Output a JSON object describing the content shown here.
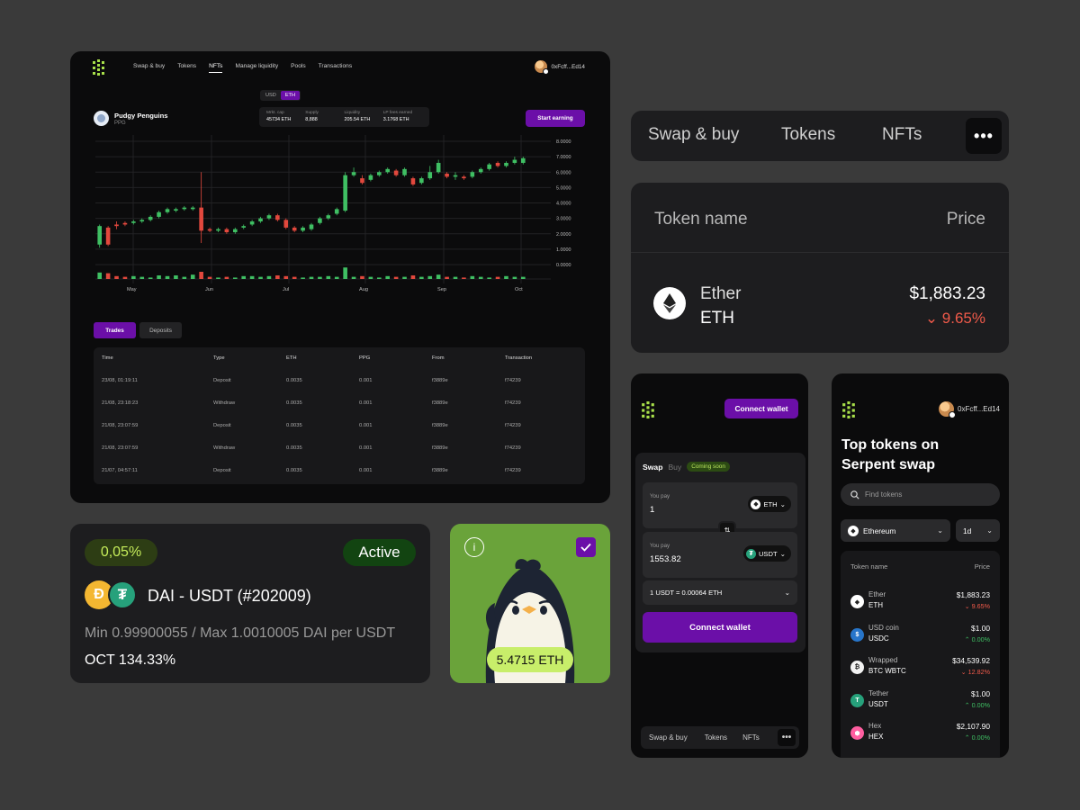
{
  "dashboard": {
    "nav": [
      "Swap & buy",
      "Tokens",
      "NFTs",
      "Manage liquidity",
      "Pools",
      "Transactions"
    ],
    "active_nav": "NFTs",
    "wallet": "0xFcff...Ed14",
    "currency_toggle": [
      "USD",
      "ETH"
    ],
    "currency_selected": "ETH",
    "collection_name": "Pudgy Penguins",
    "collection_symbol": "PPG",
    "stats": [
      {
        "label": "Mrkt. cap",
        "value": "45734 ETH"
      },
      {
        "label": "Supply",
        "value": "8,888"
      },
      {
        "label": "Liquidity",
        "value": "205.54 ETH"
      },
      {
        "label": "LP fees earned",
        "value": "3.1768 ETH"
      }
    ],
    "start_button": "Start earning",
    "tabs": [
      "Trades",
      "Deposits"
    ],
    "active_tab": "Trades",
    "table_headers": [
      "Time",
      "Type",
      "ETH",
      "PPG",
      "From",
      "Transaction"
    ],
    "table_rows": [
      [
        "23/08, 01:19:11",
        "Deposit",
        "0.0035",
        "0.001",
        "f3889e",
        "f74239"
      ],
      [
        "21/08, 23:18:23",
        "Withdraw",
        "0.0035",
        "0.001",
        "f3889e",
        "f74239"
      ],
      [
        "21/08, 23:07:59",
        "Deposit",
        "0.0035",
        "0.001",
        "f3889e",
        "f74239"
      ],
      [
        "21/08, 23:07:59",
        "Withdraw",
        "0.0035",
        "0.001",
        "f3889e",
        "f74239"
      ],
      [
        "21/07, 04:57:11",
        "Deposit",
        "0.0035",
        "0.001",
        "f3889e",
        "f74239"
      ]
    ]
  },
  "chart_data": {
    "type": "candlestick",
    "months": [
      "May",
      "Jun",
      "Jul",
      "Aug",
      "Sep",
      "Oct"
    ],
    "y_ticks": [
      "8.0000",
      "7.0000",
      "6.0000",
      "5.0000",
      "4.0000",
      "3.0000",
      "2.0000",
      "1.0000",
      "0.0000"
    ],
    "ylim": [
      0,
      8
    ],
    "candles": [
      [
        1.3,
        2.5,
        1.1,
        2.6
      ],
      [
        2.4,
        1.3,
        1.2,
        2.5
      ],
      [
        2.6,
        2.5,
        2.3,
        2.8
      ],
      [
        2.7,
        2.6,
        2.5,
        2.8
      ],
      [
        2.7,
        2.8,
        2.6,
        2.9
      ],
      [
        2.8,
        2.9,
        2.7,
        3.0
      ],
      [
        2.9,
        3.1,
        2.8,
        3.2
      ],
      [
        3.1,
        3.4,
        3.0,
        3.5
      ],
      [
        3.4,
        3.6,
        3.3,
        3.7
      ],
      [
        3.5,
        3.6,
        3.4,
        3.7
      ],
      [
        3.6,
        3.7,
        3.5,
        3.8
      ],
      [
        3.6,
        3.7,
        3.5,
        3.8
      ],
      [
        3.7,
        2.2,
        1.4,
        6.0
      ],
      [
        2.3,
        2.2,
        2.1,
        2.4
      ],
      [
        2.2,
        2.3,
        2.1,
        2.4
      ],
      [
        2.3,
        2.1,
        2.0,
        2.4
      ],
      [
        2.1,
        2.3,
        2.0,
        2.4
      ],
      [
        2.4,
        2.5,
        2.3,
        2.6
      ],
      [
        2.6,
        2.8,
        2.5,
        2.9
      ],
      [
        2.8,
        3.0,
        2.7,
        3.1
      ],
      [
        3.0,
        3.2,
        2.9,
        3.3
      ],
      [
        3.2,
        2.9,
        2.8,
        3.3
      ],
      [
        2.9,
        2.4,
        2.3,
        3.0
      ],
      [
        2.4,
        2.2,
        2.1,
        2.5
      ],
      [
        2.2,
        2.4,
        2.1,
        2.5
      ],
      [
        2.3,
        2.6,
        2.2,
        2.7
      ],
      [
        2.7,
        3.0,
        2.6,
        3.1
      ],
      [
        3.0,
        3.2,
        2.9,
        3.3
      ],
      [
        3.3,
        3.6,
        3.2,
        3.7
      ],
      [
        3.5,
        5.8,
        3.4,
        6.0
      ],
      [
        5.8,
        6.0,
        5.7,
        6.3
      ],
      [
        5.6,
        5.3,
        5.2,
        5.8
      ],
      [
        5.5,
        5.8,
        5.4,
        5.9
      ],
      [
        5.8,
        6.0,
        5.7,
        6.1
      ],
      [
        6.0,
        6.2,
        5.9,
        6.3
      ],
      [
        6.1,
        5.8,
        5.7,
        6.2
      ],
      [
        5.8,
        6.2,
        5.7,
        6.3
      ],
      [
        5.6,
        5.2,
        5.1,
        5.7
      ],
      [
        5.3,
        5.6,
        5.2,
        5.7
      ],
      [
        5.6,
        6.0,
        5.5,
        6.4
      ],
      [
        6.0,
        6.6,
        5.9,
        6.8
      ],
      [
        5.9,
        5.7,
        5.6,
        6.0
      ],
      [
        5.7,
        5.8,
        5.5,
        6.0
      ],
      [
        5.7,
        5.6,
        5.5,
        5.8
      ],
      [
        5.7,
        6.0,
        5.6,
        6.1
      ],
      [
        6.0,
        6.2,
        5.9,
        6.3
      ],
      [
        6.2,
        6.5,
        6.1,
        6.6
      ],
      [
        6.6,
        6.4,
        6.3,
        6.7
      ],
      [
        6.4,
        6.6,
        6.3,
        6.7
      ],
      [
        6.6,
        6.8,
        6.5,
        7.0
      ],
      [
        6.6,
        6.9,
        6.5,
        7.0
      ]
    ],
    "volumes": [
      0.9,
      0.8,
      0.4,
      0.3,
      0.4,
      0.3,
      0.2,
      0.5,
      0.4,
      0.5,
      0.3,
      0.6,
      1.0,
      0.3,
      0.2,
      0.3,
      0.2,
      0.4,
      0.4,
      0.3,
      0.4,
      0.5,
      0.4,
      0.3,
      0.2,
      0.3,
      0.3,
      0.4,
      0.3,
      1.6,
      0.3,
      0.4,
      0.3,
      0.2,
      0.4,
      0.3,
      0.3,
      0.5,
      0.3,
      0.4,
      0.6,
      0.3,
      0.3,
      0.2,
      0.4,
      0.3,
      0.2,
      0.3,
      0.4,
      0.3,
      0.3
    ]
  },
  "topnav": {
    "items": [
      "Swap & buy",
      "Tokens",
      "NFTs"
    ],
    "more": "•••"
  },
  "pricecard": {
    "header_name": "Token name",
    "header_price": "Price",
    "token_name": "Ether",
    "token_symbol": "ETH",
    "price": "$1,883.23",
    "change": "9.65%"
  },
  "lpcard": {
    "fee": "0,05%",
    "status": "Active",
    "title": "DAI - USDT (#202009)",
    "range": "Min 0.99900055 / Max 1.0010005 DAI per USDT",
    "oct": "OCT 134.33%",
    "colors": {
      "dai": "#f4b731",
      "usdt": "#26a17b"
    }
  },
  "nftcard": {
    "info_icon": "i",
    "price": "5.4715 ETH"
  },
  "swapcard": {
    "connect_top": "Connect wallet",
    "tab_swap": "Swap",
    "tab_buy": "Buy",
    "coming_soon": "Coming soon",
    "pay_label": "You pay",
    "pay_value_1": "1",
    "pay_token_1": "ETH",
    "pay_value_2": "1553.82",
    "pay_token_2": "USDT",
    "rate": "1 USDT = 0.00064 ETH",
    "connect_main": "Connect wallet",
    "bottom_nav": [
      "Swap & buy",
      "Tokens",
      "NFTs"
    ],
    "bottom_more": "•••"
  },
  "tokcard": {
    "wallet": "0xFcff...Ed14",
    "title_line1": "Top tokens on",
    "title_line2": "Serpent swap",
    "search_placeholder": "Find tokens",
    "network": "Ethereum",
    "timeframe": "1d",
    "col_name": "Token name",
    "col_price": "Price",
    "tokens": [
      {
        "name": "Ether",
        "symbol": "ETH",
        "price": "$1,883.23",
        "change": "9.65%",
        "dir": "down",
        "color": "#ffffff",
        "glyph": "◆"
      },
      {
        "name": "USD coin",
        "symbol": "USDC",
        "price": "$1.00",
        "change": "0.00%",
        "dir": "up",
        "color": "#2775ca",
        "glyph": "$"
      },
      {
        "name": "Wrapped",
        "symbol": "BTC WBTC",
        "price": "$34,539.92",
        "change": "12.82%",
        "dir": "down",
        "color": "#f2f2f2",
        "glyph": "₿"
      },
      {
        "name": "Tether",
        "symbol": "USDT",
        "price": "$1.00",
        "change": "0.00%",
        "dir": "up",
        "color": "#26a17b",
        "glyph": "T"
      },
      {
        "name": "Hex",
        "symbol": "HEX",
        "price": "$2,107.90",
        "change": "0.00%",
        "dir": "up",
        "color": "#ff5ea0",
        "glyph": "⬢"
      }
    ]
  },
  "colors": {
    "accent": "#6b0fa8",
    "up": "#3fbf63",
    "down": "#e2483d",
    "brand_green": "#a8e04a"
  }
}
